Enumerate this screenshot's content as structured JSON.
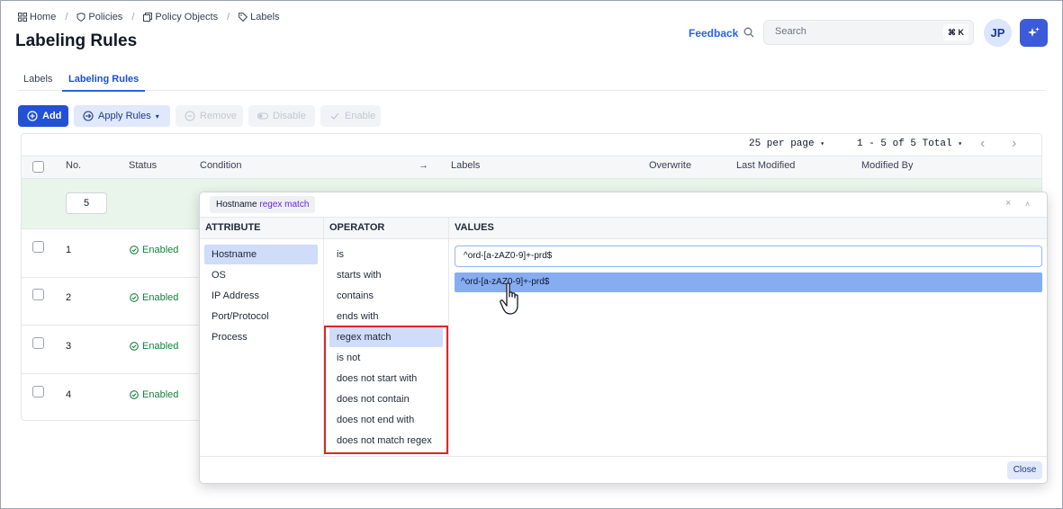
{
  "breadcrumb": [
    {
      "label": "Home",
      "icon": "grid-icon"
    },
    {
      "label": "Policies",
      "icon": "shield-icon"
    },
    {
      "label": "Policy Objects",
      "icon": "copy-icon"
    },
    {
      "label": "Labels",
      "icon": "tag-icon"
    }
  ],
  "page_title": "Labeling Rules",
  "header": {
    "feedback_label": "Feedback",
    "search_placeholder": "Search",
    "search_shortcut": "⌘ K",
    "avatar_initials": "JP"
  },
  "tabs": [
    {
      "label": "Labels",
      "active": false
    },
    {
      "label": "Labeling Rules",
      "active": true
    }
  ],
  "toolbar": {
    "add_label": "Add",
    "apply_rules_label": "Apply Rules",
    "remove_label": "Remove",
    "disable_label": "Disable",
    "enable_label": "Enable"
  },
  "pagination": {
    "per_page_label": "25 per page",
    "range_label": "1 - 5 of 5 Total"
  },
  "table": {
    "columns": [
      "No.",
      "Status",
      "Condition",
      "Labels",
      "Overwrite",
      "Last Modified",
      "Modified By"
    ],
    "arrow": "→",
    "new_row_number": "5",
    "rows": [
      {
        "no": "1",
        "status": "Enabled"
      },
      {
        "no": "2",
        "status": "Enabled"
      },
      {
        "no": "3",
        "status": "Enabled"
      },
      {
        "no": "4",
        "status": "Enabled"
      }
    ]
  },
  "condition_popover": {
    "chip_attribute": "Hostname",
    "chip_operator": "regex match",
    "close_x": "×",
    "collapse": "˄",
    "attribute_title": "ATTRIBUTE",
    "operator_title": "OPERATOR",
    "values_title": "VALUES",
    "attributes": [
      "Hostname",
      "OS",
      "IP Address",
      "Port/Protocol",
      "Process"
    ],
    "selected_attribute": "Hostname",
    "operators": [
      "is",
      "starts with",
      "contains",
      "ends with",
      "regex match",
      "is not",
      "does not start with",
      "does not contain",
      "does not end with",
      "does not match regex"
    ],
    "selected_operator": "regex match",
    "value_input": "^ord-[a-zAZ0-9]+-prd$",
    "value_option": "^ord-[a-zAZ0-9]+-prd$",
    "close_label": "Close"
  },
  "colors": {
    "primary": "#2251d6",
    "enabled_green": "#15803d",
    "highlight_red": "#dc2626",
    "selected_bg": "#cfdcfa"
  }
}
